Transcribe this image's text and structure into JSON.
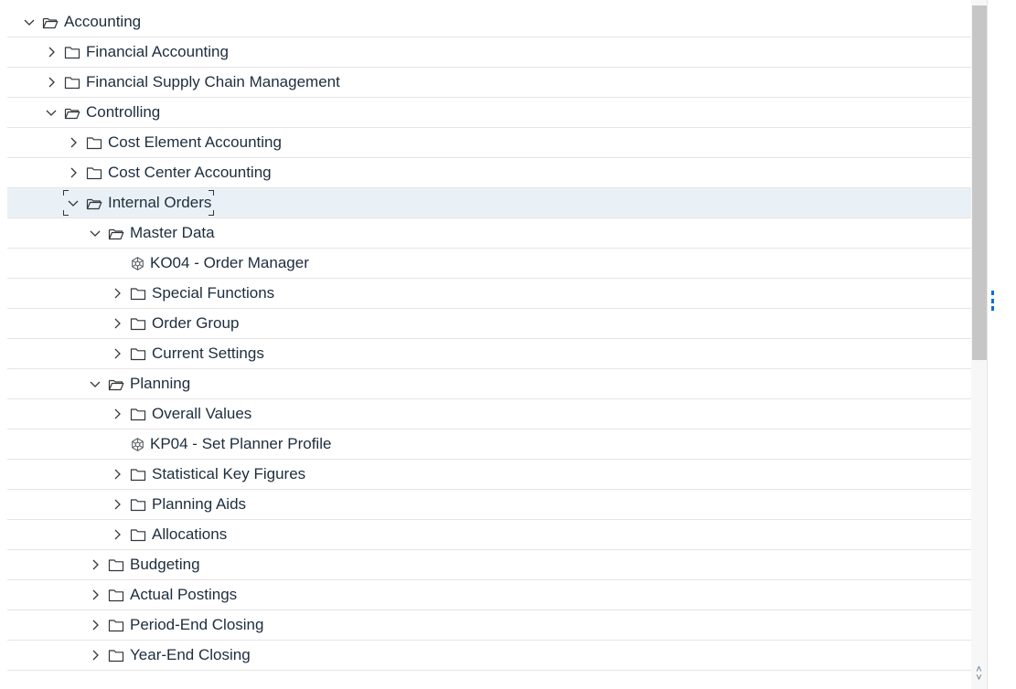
{
  "tree": {
    "nodes": [
      {
        "label": "Accounting",
        "type": "folder",
        "state": "open",
        "level": 0
      },
      {
        "label": "Financial Accounting",
        "type": "folder",
        "state": "closed",
        "level": 1
      },
      {
        "label": "Financial Supply Chain Management",
        "type": "folder",
        "state": "closed",
        "level": 1
      },
      {
        "label": "Controlling",
        "type": "folder",
        "state": "open",
        "level": 1
      },
      {
        "label": "Cost Element Accounting",
        "type": "folder",
        "state": "closed",
        "level": 2
      },
      {
        "label": "Cost Center Accounting",
        "type": "folder",
        "state": "closed",
        "level": 2
      },
      {
        "label": "Internal Orders",
        "type": "folder",
        "state": "open",
        "level": 2,
        "selected": true
      },
      {
        "label": "Master Data",
        "type": "folder",
        "state": "open",
        "level": 3
      },
      {
        "label": "KO04 - Order Manager",
        "type": "transaction",
        "level": 4
      },
      {
        "label": "Special Functions",
        "type": "folder",
        "state": "closed",
        "level": 4
      },
      {
        "label": "Order Group",
        "type": "folder",
        "state": "closed",
        "level": 4
      },
      {
        "label": "Current Settings",
        "type": "folder",
        "state": "closed",
        "level": 4
      },
      {
        "label": "Planning",
        "type": "folder",
        "state": "open",
        "level": 3
      },
      {
        "label": "Overall Values",
        "type": "folder",
        "state": "closed",
        "level": 4
      },
      {
        "label": "KP04 - Set Planner Profile",
        "type": "transaction",
        "level": 4
      },
      {
        "label": "Statistical Key Figures",
        "type": "folder",
        "state": "closed",
        "level": 4
      },
      {
        "label": "Planning Aids",
        "type": "folder",
        "state": "closed",
        "level": 4
      },
      {
        "label": "Allocations",
        "type": "folder",
        "state": "closed",
        "level": 4
      },
      {
        "label": "Budgeting",
        "type": "folder",
        "state": "closed",
        "level": 3
      },
      {
        "label": "Actual Postings",
        "type": "folder",
        "state": "closed",
        "level": 3
      },
      {
        "label": "Period-End Closing",
        "type": "folder",
        "state": "closed",
        "level": 3
      },
      {
        "label": "Year-End Closing",
        "type": "folder",
        "state": "closed",
        "level": 3
      }
    ]
  },
  "colors": {
    "selected_row": "#eaf1f6",
    "text": "#1d2d3e",
    "icon": "#32363a",
    "accent": "#0a6ed1"
  }
}
